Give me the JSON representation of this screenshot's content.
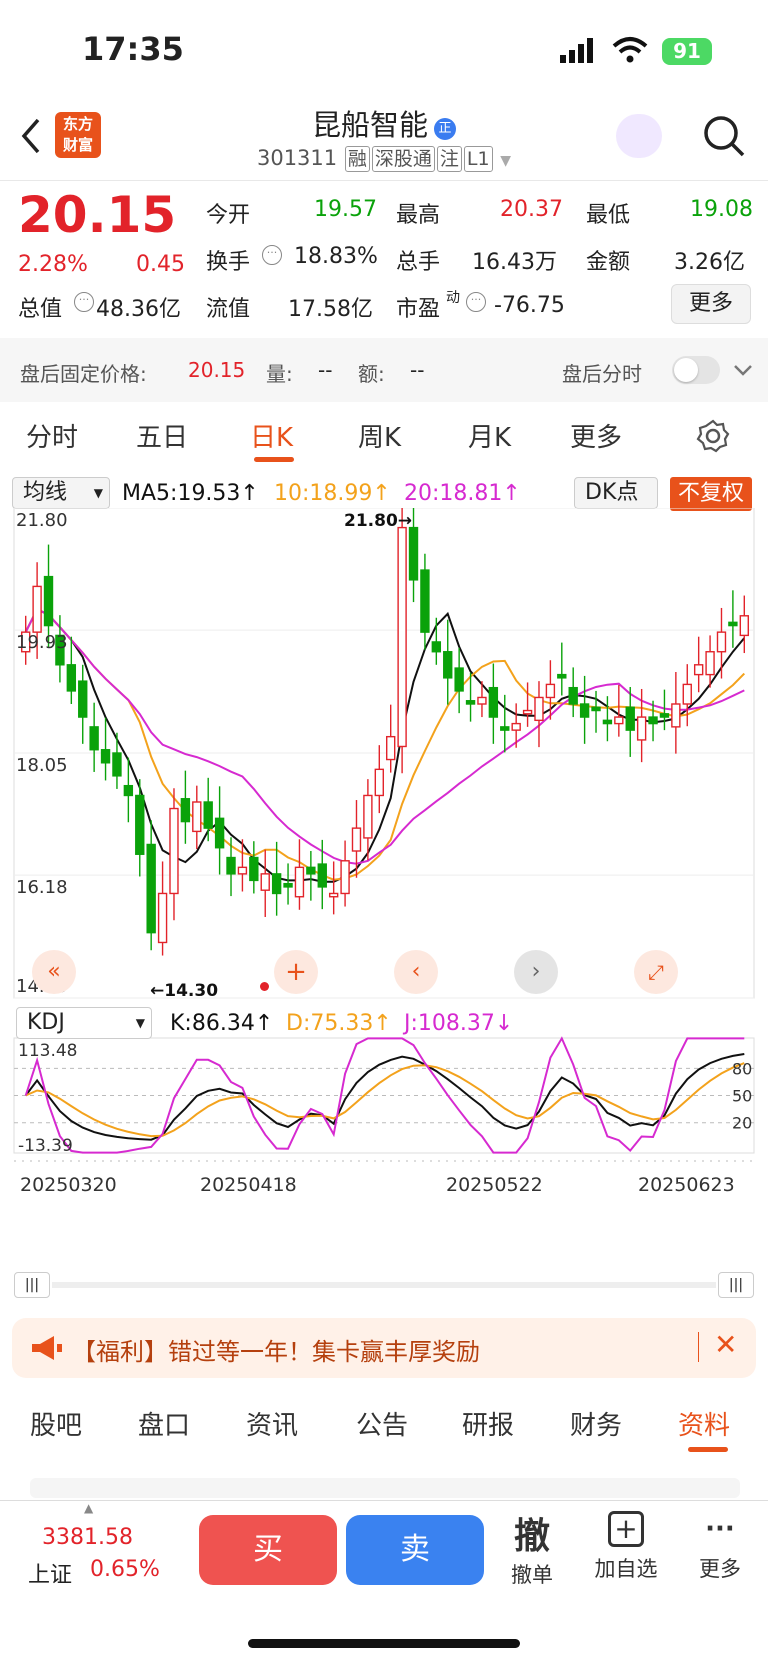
{
  "status": {
    "time": "17:35",
    "battery": "91"
  },
  "header": {
    "name": "昆船智能",
    "code": "301311",
    "tags": [
      "融",
      "深股通",
      "注",
      "L1"
    ]
  },
  "quote": {
    "price": "20.15",
    "pct": "2.28%",
    "chg": "0.45",
    "open_label": "今开",
    "open": "19.57",
    "high_label": "最高",
    "high": "20.37",
    "low_label": "最低",
    "low": "19.08",
    "turnover_label": "换手",
    "turnover": "18.83%",
    "vol_label": "总手",
    "vol": "16.43万",
    "amt_label": "金额",
    "amt": "3.26亿",
    "mcap_label": "总值",
    "mcap": "48.36亿",
    "float_label": "流值",
    "float": "17.58亿",
    "pe_label": "市盈",
    "pe_sup": "动",
    "pe": "-76.75",
    "more": "更多"
  },
  "after": {
    "label": "盘后固定价格:",
    "price": "20.15",
    "vol_label": "量:",
    "vol": "--",
    "amt_label": "额:",
    "amt": "--",
    "toggle_label": "盘后分时"
  },
  "tabs": [
    "分时",
    "五日",
    "日K",
    "周K",
    "月K",
    "更多"
  ],
  "ma": {
    "select": "均线",
    "ma5": "MA5:19.53↑",
    "ma10": "10:18.99↑",
    "ma20": "20:18.81↑",
    "dk": "DK点",
    "fq": "不复权"
  },
  "price_axis": [
    "21.80",
    "19.93",
    "18.05",
    "16.18",
    "14.30"
  ],
  "annot": {
    "high": "21.80→",
    "low": "←14.30"
  },
  "kdj": {
    "select": "KDJ",
    "k": "K:86.34↑",
    "d": "D:75.33↑",
    "j": "J:108.37↓",
    "axis_top": "113.48",
    "axis_bot": "-13.39",
    "lv80": "80",
    "lv50": "50",
    "lv20": "20"
  },
  "dates": [
    "20250320",
    "20250418",
    "20250522",
    "20250623"
  ],
  "colors": {
    "up": "#e2232a",
    "down": "#0aa20a",
    "ma5": "#111111",
    "ma10": "#f3a21c",
    "ma20": "#d62ad0",
    "accent": "#e8521b"
  },
  "banner": {
    "text": "【福利】错过等一年！集卡赢丰厚奖励"
  },
  "bottom_tabs": [
    "股吧",
    "盘口",
    "资讯",
    "公告",
    "研报",
    "财务",
    "资料"
  ],
  "footer": {
    "index_val": "3381.58",
    "index_name": "上证",
    "index_pct": "0.65%",
    "buy": "买",
    "sell": "卖",
    "cancel_glyph": "撤",
    "cancel": "撤单",
    "add": "加自选",
    "more": "更多"
  }
}
